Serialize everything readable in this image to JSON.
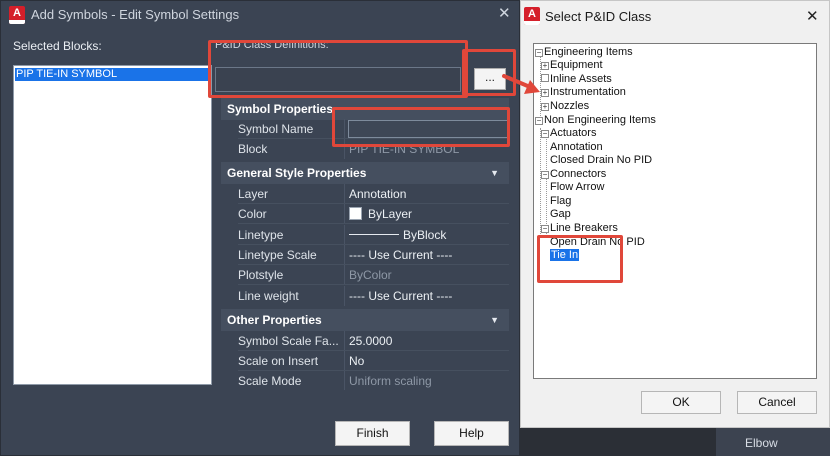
{
  "left_dialog": {
    "title": "Add Symbols - Edit Symbol Settings",
    "selected_blocks_label": "Selected Blocks:",
    "selected_block": "PIP TIE-IN SYMBOL",
    "pid_class_label": "P&ID Class Definitions:",
    "browse_label": "...",
    "sections": {
      "symbol": {
        "title": "Symbol Properties",
        "rows": [
          {
            "name": "Symbol Name",
            "value": ""
          },
          {
            "name": "Block",
            "value": "PIP TIE-IN SYMBOL"
          }
        ]
      },
      "general": {
        "title": "General Style Properties",
        "rows": [
          {
            "name": "Layer",
            "value": "Annotation"
          },
          {
            "name": "Color",
            "value": "ByLayer"
          },
          {
            "name": "Linetype",
            "value": "ByBlock"
          },
          {
            "name": "Linetype Scale",
            "value": "---- Use Current ----"
          },
          {
            "name": "Plotstyle",
            "value": "ByColor"
          },
          {
            "name": "Line weight",
            "value": "---- Use Current ----"
          }
        ]
      },
      "other": {
        "title": "Other Properties",
        "rows": [
          {
            "name": "Symbol Scale Fa...",
            "value": "25.0000"
          },
          {
            "name": "Scale on Insert",
            "value": "No"
          },
          {
            "name": "Scale Mode",
            "value": "Uniform scaling"
          }
        ]
      }
    },
    "finish_label": "Finish",
    "help_label": "Help"
  },
  "right_dialog": {
    "title": "Select P&ID Class",
    "tree": {
      "engineering": "Engineering Items",
      "equipment": "Equipment",
      "inline_assets": "Inline Assets",
      "instrumentation": "Instrumentation",
      "nozzles": "Nozzles",
      "non_engineering": "Non Engineering Items",
      "actuators": "Actuators",
      "annotation": "Annotation",
      "closed_drain": "Closed Drain No PID",
      "connectors": "Connectors",
      "flow_arrow": "Flow Arrow",
      "flag": "Flag",
      "gap": "Gap",
      "line_breakers": "Line Breakers",
      "open_drain": "Open Drain No PID",
      "tie_in": "Tie In"
    },
    "ok_label": "OK",
    "cancel_label": "Cancel"
  },
  "background": {
    "elbow_label": "Elbow"
  },
  "colors": {
    "highlight": "#e0473a",
    "selection": "#1a73e8",
    "dialog_dark": "#3b4453"
  }
}
